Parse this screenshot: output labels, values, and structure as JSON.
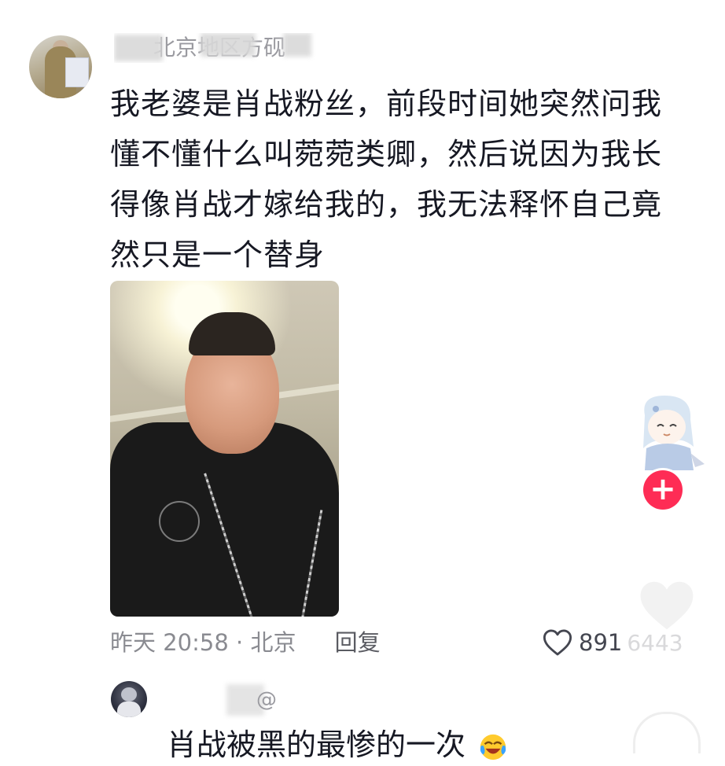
{
  "comment_1": {
    "username": "北京地区方砚",
    "text": "我老婆是肖战粉丝，前段时间她突然问我懂不懂什么叫菀菀类卿，然后说因为我长得像肖战才嫁给我的，我无法释怀自己竟然只是一个替身",
    "time_location": "昨天 20:58 · 北京",
    "reply_label": "回复",
    "like_count": "891",
    "overlay_count": "6443"
  },
  "floating": {
    "plus_label": "+"
  },
  "comment_2": {
    "username": "@",
    "text": "肖战被黑的最惨的一次"
  },
  "colors": {
    "accent_red": "#fe2c55",
    "text_primary": "#161823",
    "text_secondary": "#8a8b91"
  }
}
